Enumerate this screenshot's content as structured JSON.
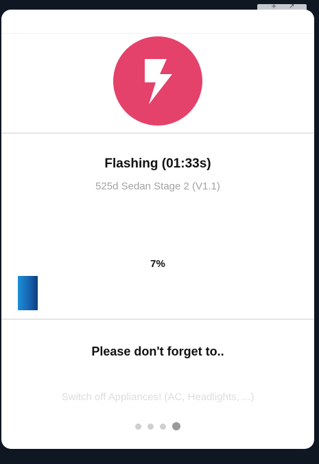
{
  "dialog": {
    "title": "Flashing (01:33s)",
    "subtitle": "525d Sedan Stage 2 (V1.1)",
    "progress_label": "7%",
    "progress_fraction": 0.07,
    "reminder_title": "Please don't forget to..",
    "tip_text": "Switch off Appliances! (AC, Headlights, ...)",
    "icon": "lightning-bolt-icon",
    "accent_color": "#e4426b",
    "progress_color": "#1765b3"
  },
  "pager": {
    "count": 4,
    "active_index": 3
  }
}
